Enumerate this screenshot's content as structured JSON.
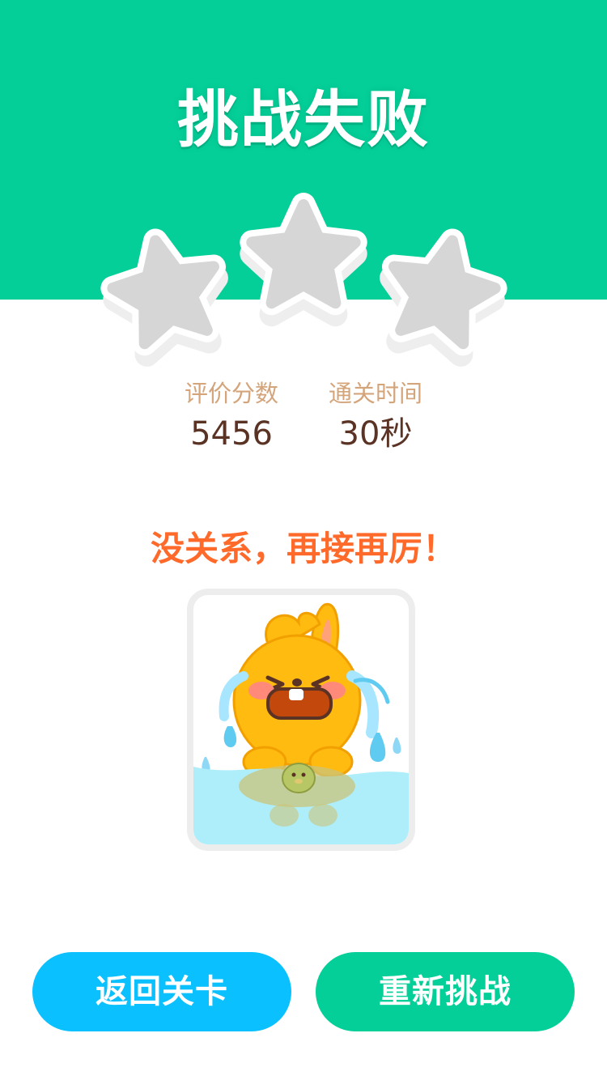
{
  "result": {
    "title": "挑战失败",
    "stars_earned": 0,
    "stars_total": 3
  },
  "stats": {
    "score_label": "评价分数",
    "score_value": "5456",
    "time_label": "通关时间",
    "time_value": "30秒"
  },
  "message": "没关系，再接再厉！",
  "mascot": {
    "icon": "crying-bunny-mascot-icon"
  },
  "buttons": {
    "back_label": "返回关卡",
    "retry_label": "重新挑战"
  },
  "colors": {
    "header_green": "#04cf98",
    "back_button_blue": "#0bc0ff",
    "retry_button_green": "#04cf98",
    "message_orange": "#ff6a2b",
    "star_empty_gray": "#d6d6d6"
  }
}
